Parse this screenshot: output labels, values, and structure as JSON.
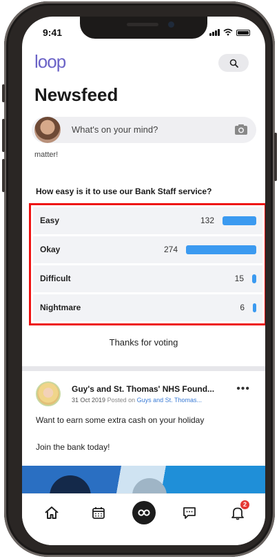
{
  "status_bar": {
    "time": "9:41"
  },
  "header": {
    "logo": "loop",
    "title": "Newsfeed"
  },
  "composer": {
    "placeholder": "What's on your mind?"
  },
  "previous_post_fragment": "matter!",
  "poll": {
    "question": "How easy is it to use our Bank Staff service?",
    "options": [
      {
        "label": "Easy",
        "count": "132",
        "share": 0.48
      },
      {
        "label": "Okay",
        "count": "274",
        "share": 1.0
      },
      {
        "label": "Difficult",
        "count": "15",
        "share": 0.055
      },
      {
        "label": "Nightmare",
        "count": "6",
        "share": 0.022
      }
    ],
    "result_message": "Thanks for voting",
    "highlight_color": "#ee1111",
    "bar_color": "#3b9af0"
  },
  "post": {
    "author": "Guy's and St. Thomas' NHS Found...",
    "date": "31 Oct 2019",
    "posted_on_prefix": "Posted on",
    "posted_on_link": "Guys and St. Thomas...",
    "more": "•••",
    "body_line1": "Want to earn some extra cash on your holiday",
    "body_line2": "Join the bank today!"
  },
  "tab_bar": {
    "items": [
      {
        "name": "home-icon"
      },
      {
        "name": "calendar-icon"
      },
      {
        "name": "loop-icon"
      },
      {
        "name": "chat-icon"
      },
      {
        "name": "bell-icon"
      }
    ],
    "notification_badge": "2"
  }
}
